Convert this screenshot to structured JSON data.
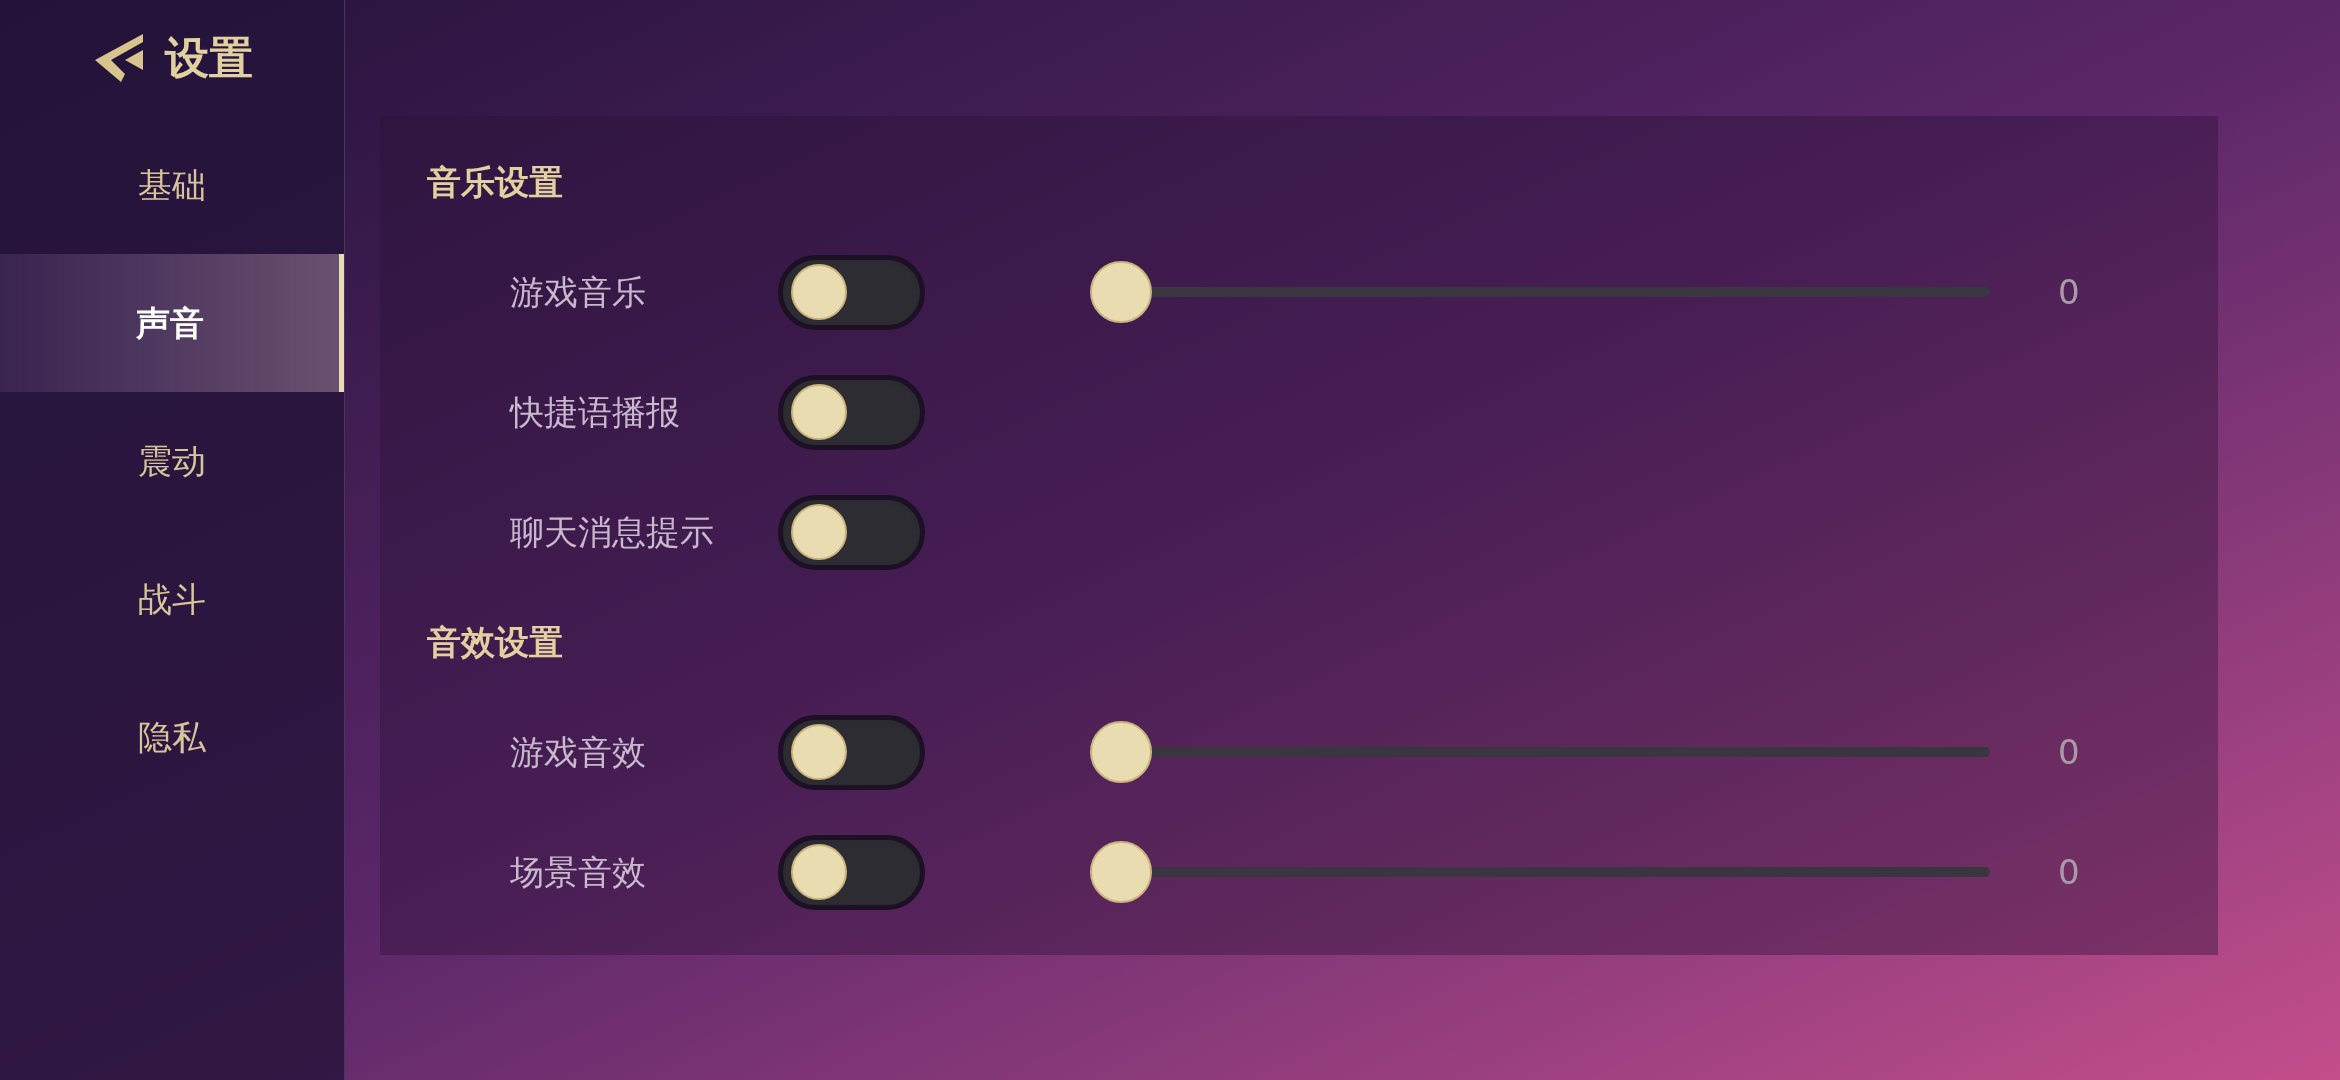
{
  "header": {
    "title": "设置"
  },
  "nav": [
    {
      "label": "基础",
      "selected": false
    },
    {
      "label": "声音",
      "selected": true
    },
    {
      "label": "震动",
      "selected": false
    },
    {
      "label": "战斗",
      "selected": false
    },
    {
      "label": "隐私",
      "selected": false
    }
  ],
  "sections": [
    {
      "heading": "音乐设置",
      "rows": [
        {
          "label": "游戏音乐",
          "on": false,
          "slider": {
            "level": 0,
            "reading": "0"
          }
        },
        {
          "label": "快捷语播报",
          "on": false
        },
        {
          "label": "聊天消息提示",
          "on": false
        }
      ]
    },
    {
      "heading": "音效设置",
      "rows": [
        {
          "label": "游戏音效",
          "on": false,
          "slider": {
            "level": 0,
            "reading": "0"
          }
        },
        {
          "label": "场景音效",
          "on": false,
          "slider": {
            "level": 0,
            "reading": "0"
          }
        }
      ]
    }
  ]
}
